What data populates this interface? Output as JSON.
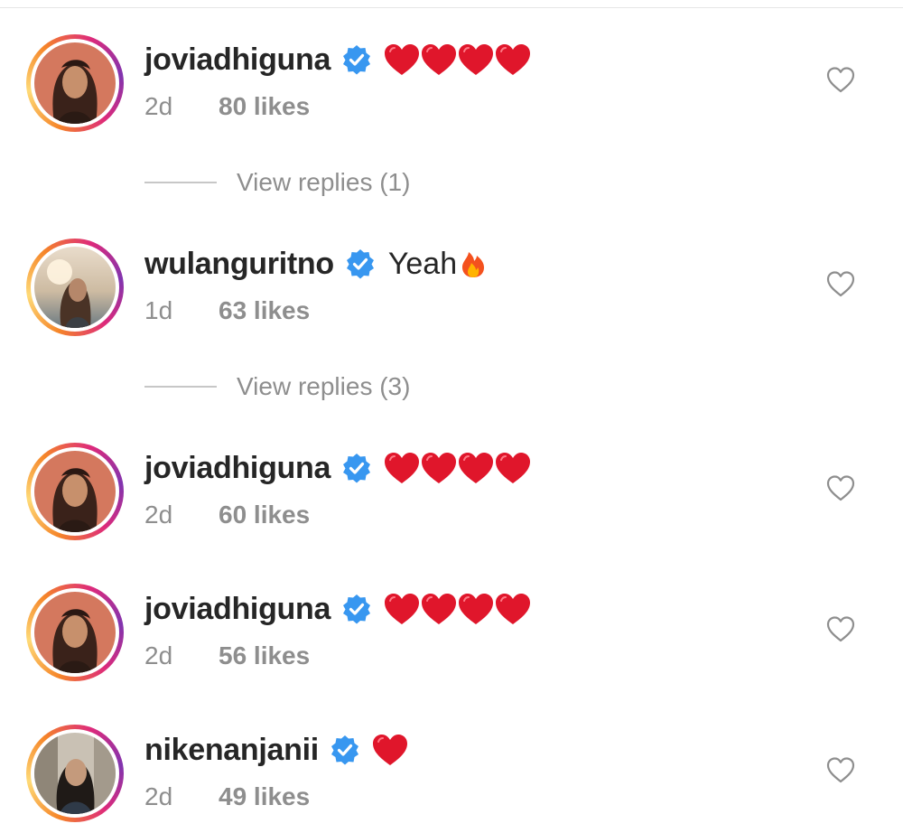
{
  "comments": [
    {
      "username": "joviadhiguna",
      "verified": true,
      "text": "",
      "reaction": "hearts",
      "heart_count": 4,
      "time": "2d",
      "likes": "80 likes",
      "avatar": "avatar-joviadhiguna",
      "view_replies": "View replies (1)"
    },
    {
      "username": "wulanguritno",
      "verified": true,
      "text": "Yeah",
      "reaction": "fire",
      "heart_count": 0,
      "time": "1d",
      "likes": "63 likes",
      "avatar": "avatar-wulanguritno",
      "view_replies": "View replies (3)"
    },
    {
      "username": "joviadhiguna",
      "verified": true,
      "text": "",
      "reaction": "hearts",
      "heart_count": 4,
      "time": "2d",
      "likes": "60 likes",
      "avatar": "avatar-joviadhiguna"
    },
    {
      "username": "joviadhiguna",
      "verified": true,
      "text": "",
      "reaction": "hearts",
      "heart_count": 4,
      "time": "2d",
      "likes": "56 likes",
      "avatar": "avatar-joviadhiguna"
    },
    {
      "username": "nikenanjanii",
      "verified": true,
      "text": "",
      "reaction": "hearts",
      "heart_count": 1,
      "time": "2d",
      "likes": "49 likes",
      "avatar": "avatar-nikenanjanii"
    }
  ],
  "icons": {
    "verified": "verified-badge-icon",
    "like": "heart-outline-icon",
    "heart_emoji": "red-heart-emoji-icon",
    "fire_emoji": "fire-emoji-icon"
  },
  "colors": {
    "text": "#262626",
    "secondary": "#8e8e8e",
    "verified_blue": "#3897f0",
    "heart_red": "#e0162b",
    "divider": "#c7c7c7"
  }
}
